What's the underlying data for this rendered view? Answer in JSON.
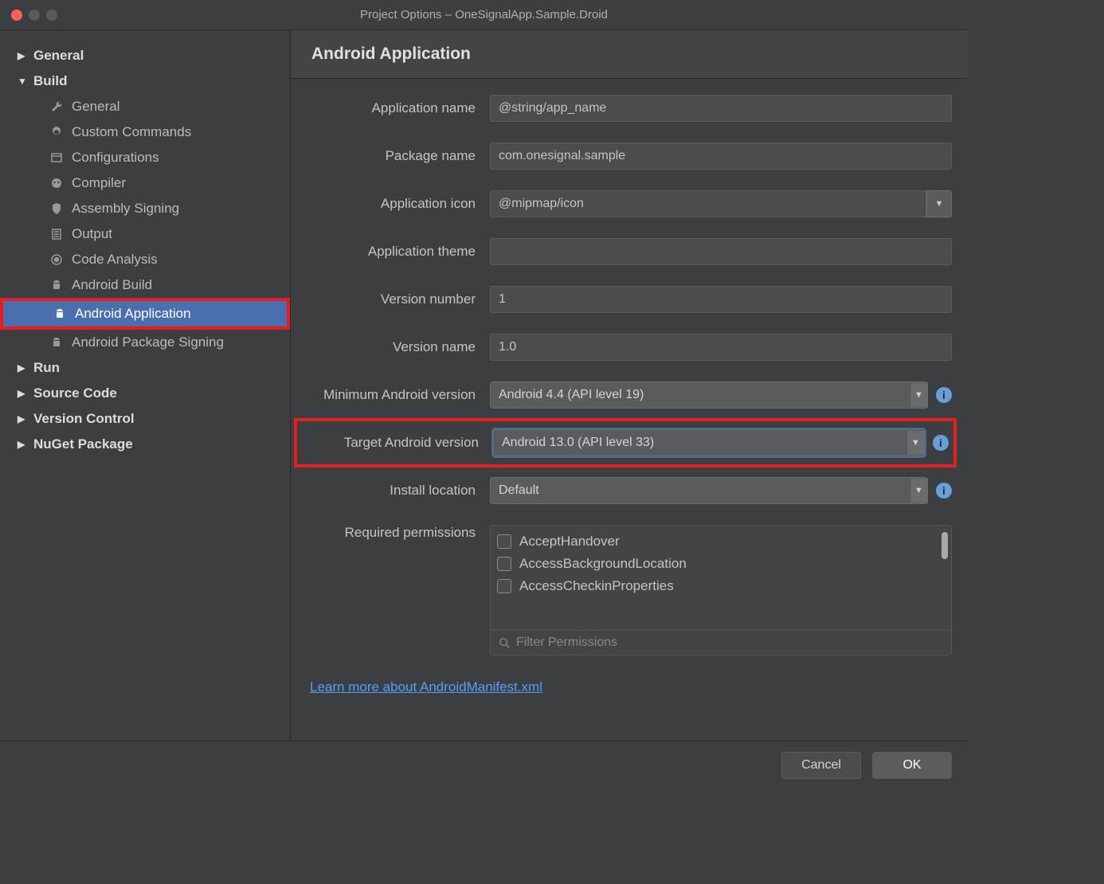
{
  "window": {
    "title": "Project Options – OneSignalApp.Sample.Droid"
  },
  "sidebar": {
    "general": "General",
    "build": "Build",
    "build_items": {
      "general": "General",
      "custom_commands": "Custom Commands",
      "configurations": "Configurations",
      "compiler": "Compiler",
      "assembly_signing": "Assembly Signing",
      "output": "Output",
      "code_analysis": "Code Analysis",
      "android_build": "Android Build",
      "android_application": "Android Application",
      "android_package_signing": "Android Package Signing"
    },
    "run": "Run",
    "source_code": "Source Code",
    "version_control": "Version Control",
    "nuget_package": "NuGet Package"
  },
  "main": {
    "header": "Android Application",
    "labels": {
      "app_name": "Application name",
      "package_name": "Package name",
      "app_icon": "Application icon",
      "app_theme": "Application theme",
      "version_number": "Version number",
      "version_name": "Version name",
      "min_version": "Minimum Android version",
      "target_version": "Target Android version",
      "install_location": "Install location",
      "required_permissions": "Required permissions"
    },
    "values": {
      "app_name": "@string/app_name",
      "package_name": "com.onesignal.sample",
      "app_icon": "@mipmap/icon",
      "app_theme": "",
      "version_number": "1",
      "version_name": "1.0",
      "min_version": "Android 4.4 (API level 19)",
      "target_version": "Android 13.0 (API level 33)",
      "install_location": "Default"
    },
    "permissions": {
      "p1": "AcceptHandover",
      "p2": "AccessBackgroundLocation",
      "p3": "AccessCheckinProperties",
      "filter_placeholder": "Filter Permissions"
    },
    "link": "Learn more about AndroidManifest.xml"
  },
  "footer": {
    "cancel": "Cancel",
    "ok": "OK"
  }
}
